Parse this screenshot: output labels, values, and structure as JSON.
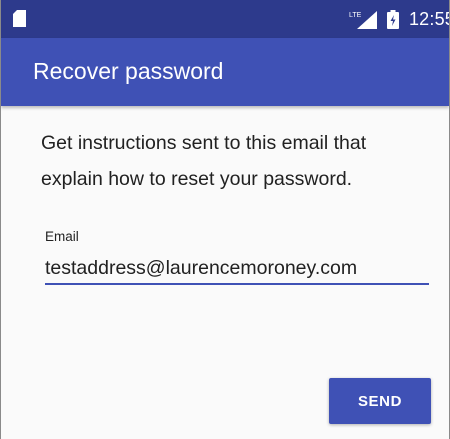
{
  "status_bar": {
    "network_label": "LTE",
    "time": "12:55"
  },
  "app_bar": {
    "title": "Recover password"
  },
  "main": {
    "instructions": "Get instructions sent to this email that explain how to reset your password.",
    "email_field": {
      "label": "Email",
      "value": "testaddress@laurencemoroney.com"
    },
    "send_button_label": "SEND"
  },
  "icons": {
    "sim": "sim-card-icon",
    "signal": "lte-signal-icon",
    "battery": "battery-charging-icon"
  },
  "colors": {
    "status_bar": "#2d3a8c",
    "primary": "#3f51b5",
    "background": "#fafafa",
    "text": "#212121"
  }
}
